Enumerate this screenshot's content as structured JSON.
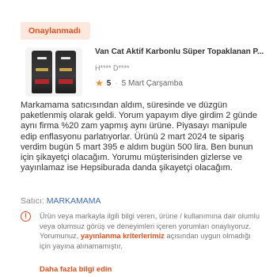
{
  "status_badge": "Onaylanmadı",
  "product": {
    "name": "Van Cat Aktif Karbonlu Süper Topaklanan P...",
    "user": "H**** D****"
  },
  "rating": {
    "score": "5",
    "date": "5 Mart Çarşamba"
  },
  "review_text": "Markamama satıcısından aldım, süresinde ve düzgün paketlenmiş olarak geldi. Yorum yapayım diye girdim 2 günde aynı firma %20 zam yapmış aynı ürüne. Piyasayı manipule edip enflasyonu parlatıyorlar. Ürünü 2 mart 2024 te sipariş verdim bugün 5 mart 395 e aldım bugün 500 lira. Ben bunun için şikayetçi olacağım. Yorumu müşterisinden gizlerse ve yayınlamaz ise Hepsiburada danda şikayetçi olacağım.",
  "seller": {
    "label": "Satıcı:",
    "name": "MARKAMAMA"
  },
  "notice": {
    "text_before": "Ürün veya markayla ilgili bilgi veren, ürüne / kullanımına dair olumlu veya olumsuz görüş ve deneyimleri içeren yorumları onaylıyoruz. Yorumunuz,",
    "link": "yayınlanma kriterlerimiz",
    "text_after": "açısından uygun olmadığı için yayına alınamamıştır."
  },
  "more_info": "Daha fazla bilgi edin",
  "colors": {
    "accent": "#e04e1b",
    "badge_bg": "#fde8de",
    "star": "#f28c28",
    "link": "#3c6bb7"
  },
  "icons": {
    "star": "star-icon",
    "info": "info-icon"
  }
}
